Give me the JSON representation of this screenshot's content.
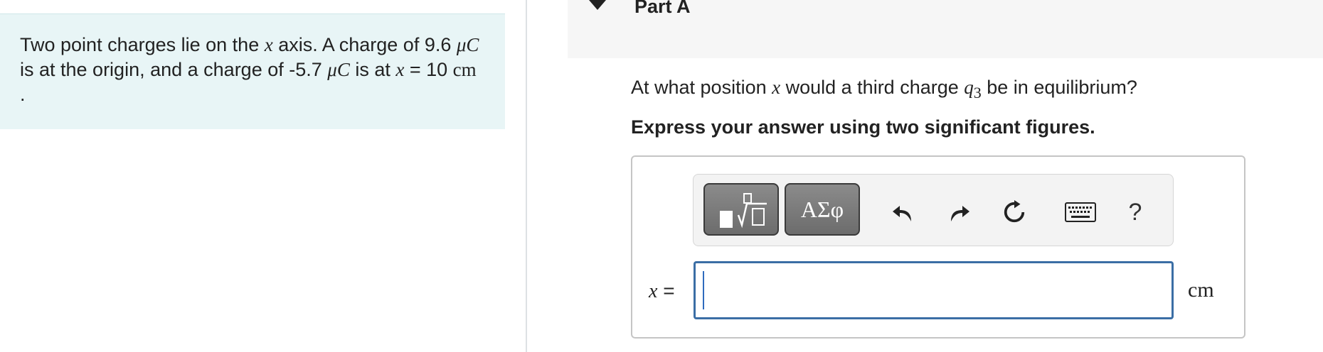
{
  "problem": {
    "seg1": "Two point charges lie on the ",
    "var_x": "x",
    "seg2": " axis. A charge of 9.6 ",
    "unit_mu": "μC",
    "seg3": " is at the origin, and a charge of -5.7 ",
    "unit_mu2": "μC",
    "seg4": " is at ",
    "var_x2": "x",
    "seg5": " = 10 ",
    "unit_cm": "cm",
    "seg6": " ."
  },
  "part": {
    "title": "Part A"
  },
  "question": {
    "seg1": "At what position ",
    "var_x": "x",
    "seg2": " would a third charge ",
    "var_q": "q",
    "sub": "3",
    "seg3": " be in equilibrium?"
  },
  "instruction": "Express your answer using two significant figures.",
  "toolbar": {
    "symbols_label": "ΑΣφ",
    "help_label": "?"
  },
  "answer": {
    "variable": "x",
    "equals": " =",
    "value": "",
    "unit": "cm"
  }
}
